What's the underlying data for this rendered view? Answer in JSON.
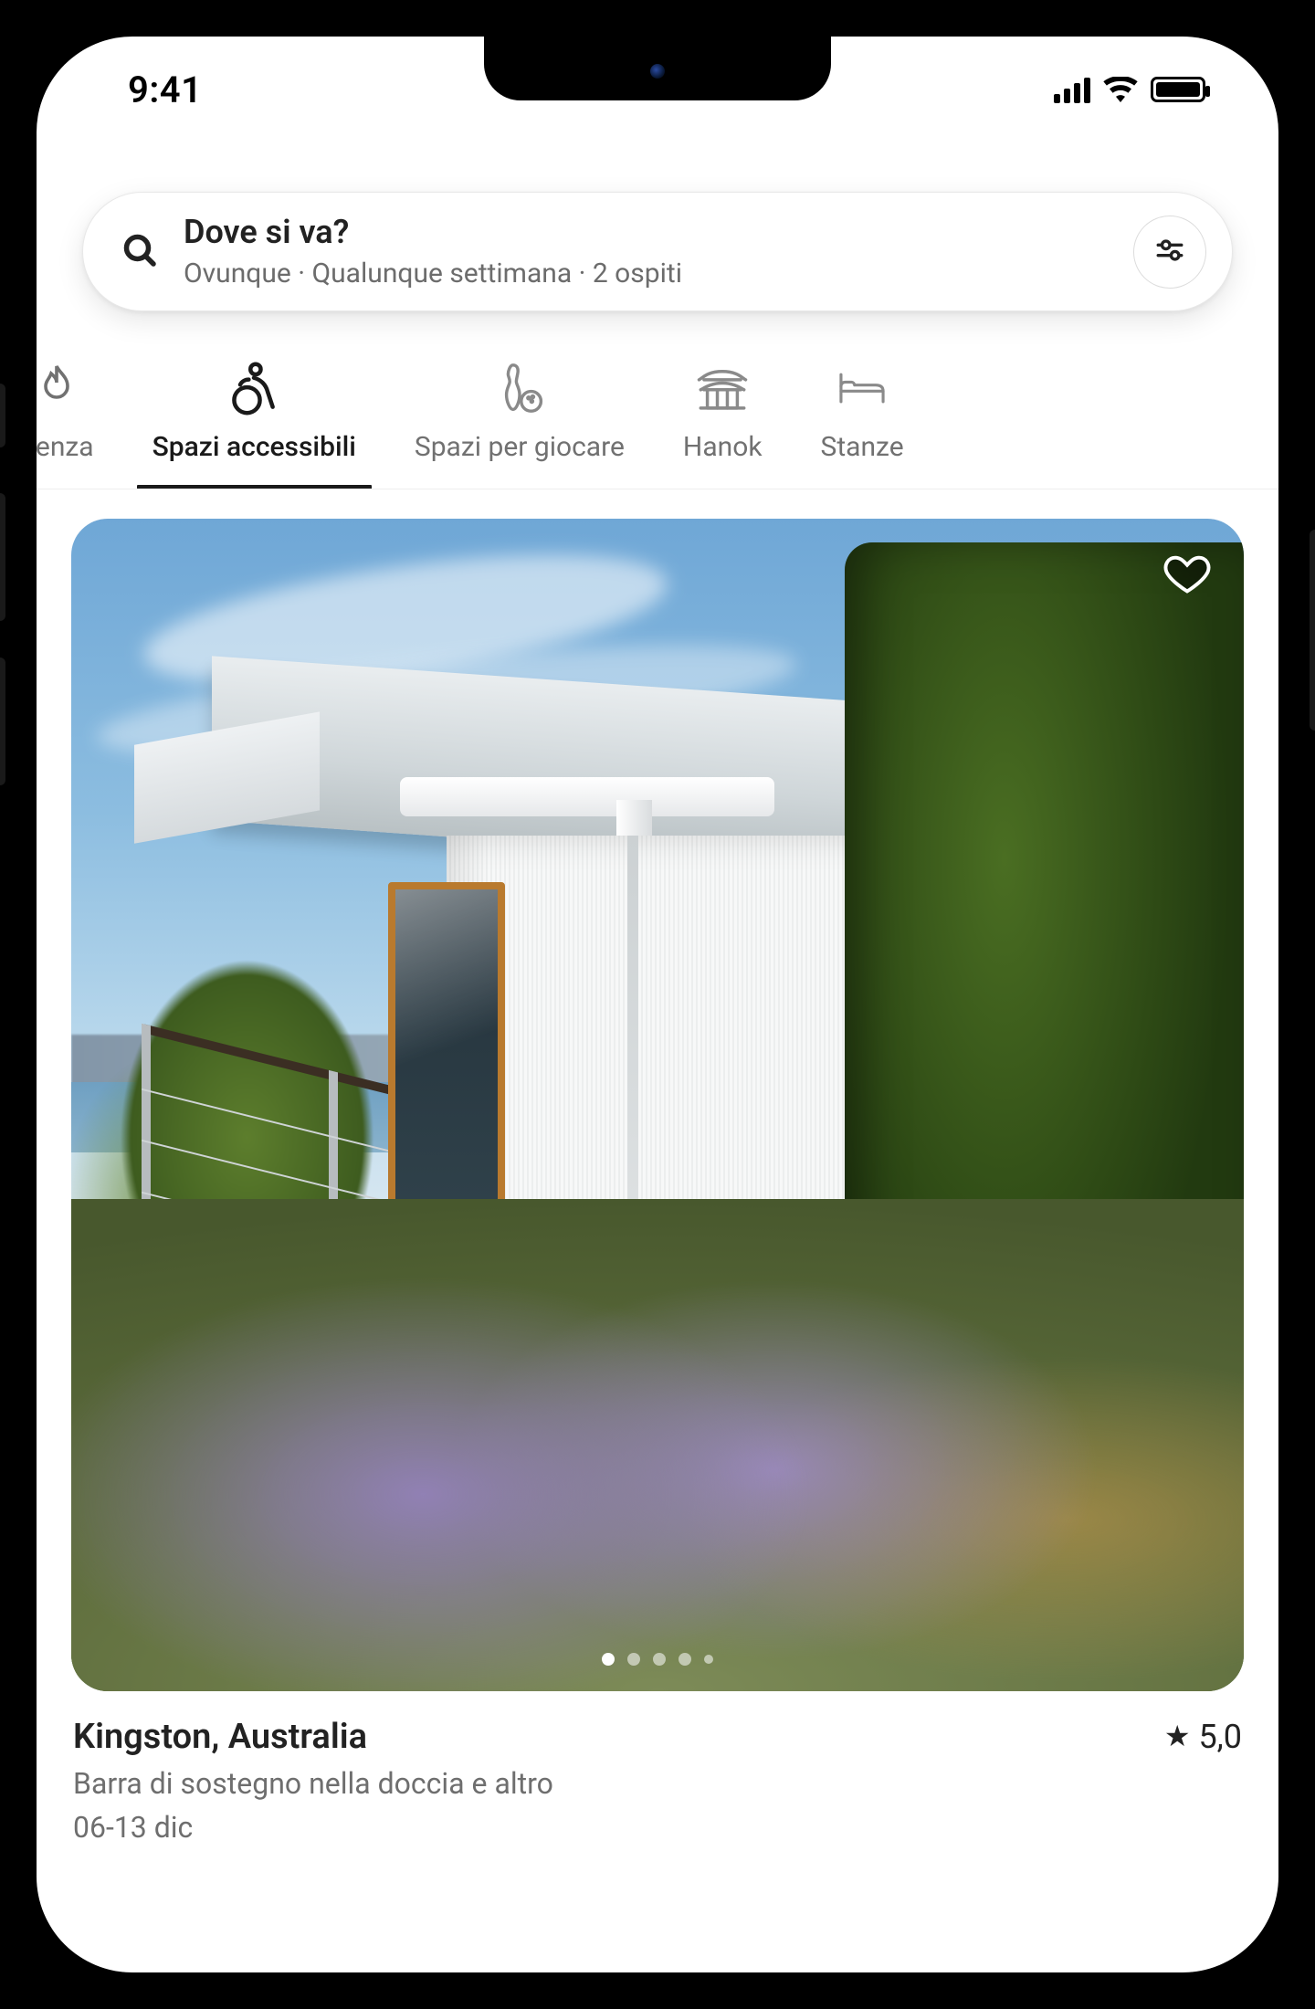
{
  "status_bar": {
    "time": "9:41"
  },
  "search": {
    "title": "Dove si va?",
    "subtitle": "Ovunque · Qualunque settimana · 2 ospiti"
  },
  "tabs": [
    {
      "id": "trend",
      "label": "denza",
      "active": false
    },
    {
      "id": "accessible",
      "label": "Spazi accessibili",
      "active": true
    },
    {
      "id": "play",
      "label": "Spazi per giocare",
      "active": false
    },
    {
      "id": "hanok",
      "label": "Hanok",
      "active": false
    },
    {
      "id": "rooms",
      "label": "Stanze",
      "active": false
    }
  ],
  "listing": {
    "location": "Kingston, Australia",
    "rating": "5,0",
    "feature_line": "Barra di sostegno nella doccia e altro",
    "date_line": "06-13 dic"
  }
}
